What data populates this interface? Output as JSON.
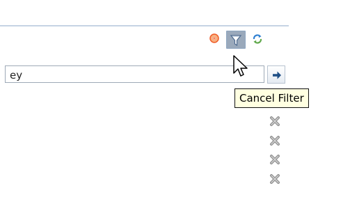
{
  "search": {
    "value": "ey"
  },
  "toolbar": {
    "icons": [
      "add-icon",
      "filter-icon",
      "refresh-icon"
    ]
  },
  "go_button": {
    "icon": "arrow-right-icon"
  },
  "tooltip": {
    "text": "Cancel Filter"
  },
  "rows": [
    {
      "icon": "remove-icon"
    },
    {
      "icon": "remove-icon"
    },
    {
      "icon": "remove-icon"
    },
    {
      "icon": "remove-icon"
    }
  ],
  "colors": {
    "rule": "#c6d3e4",
    "filter_button_bg": "#9aa9bb",
    "tooltip_bg": "#ffffe1",
    "add_icon": "#f05a28",
    "refresh_icon": "#2f7fd1",
    "remove_icon": "#9a9a9a"
  }
}
